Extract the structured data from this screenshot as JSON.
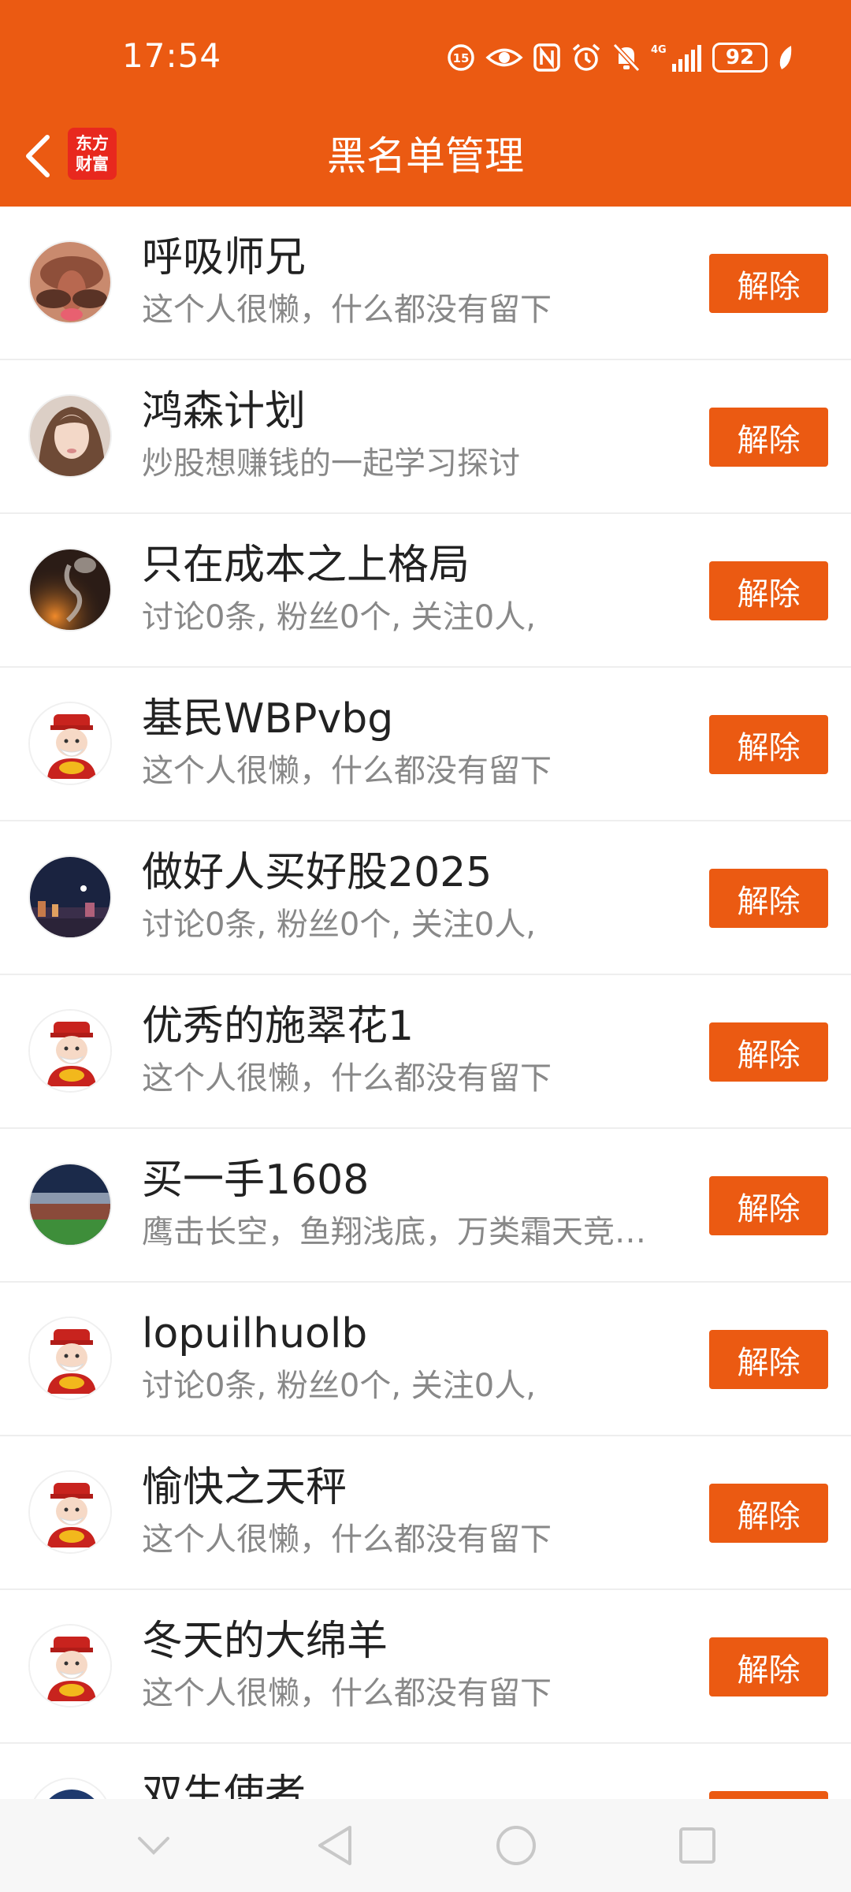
{
  "status_bar": {
    "time": "17:54",
    "battery": "92",
    "network": "4G"
  },
  "nav": {
    "title": "黑名单管理",
    "logo_line1": "东方",
    "logo_line2": "财富"
  },
  "colors": {
    "accent": "#EB5A12",
    "logo_red": "#E8281E",
    "name_text": "#222222",
    "bio_text": "#888888"
  },
  "button_label": "解除",
  "blocked_users": [
    {
      "name": "呼吸师兄",
      "bio": "这个人很懒，什么都没有留下",
      "avatar": "face-closeup-avatar"
    },
    {
      "name": "鸿森计划",
      "bio": "炒股想赚钱的一起学习探讨",
      "avatar": "woman-portrait-avatar"
    },
    {
      "name": "只在成本之上格局",
      "bio": "讨论0条, 粉丝0个, 关注0人,",
      "avatar": "smoke-photo-avatar"
    },
    {
      "name": "基民WBPvbg",
      "bio": "这个人很懒，什么都没有留下",
      "avatar": "fortune-god-avatar"
    },
    {
      "name": "做好人买好股2025",
      "bio": "讨论0条, 粉丝0个, 关注0人,",
      "avatar": "night-city-avatar"
    },
    {
      "name": "优秀的施翠花1",
      "bio": "这个人很懒，什么都没有留下",
      "avatar": "fortune-god-avatar"
    },
    {
      "name": "买一手1608",
      "bio": "鹰击长空，鱼翔浅底，万类霜天竞…",
      "avatar": "stadium-avatar"
    },
    {
      "name": "lopuilhuolb",
      "bio": "讨论0条, 粉丝0个, 关注0人,",
      "avatar": "fortune-god-avatar"
    },
    {
      "name": "愉快之天秤",
      "bio": "这个人很懒，什么都没有留下",
      "avatar": "fortune-god-avatar"
    },
    {
      "name": "冬天的大绵羊",
      "bio": "这个人很懒，什么都没有留下",
      "avatar": "fortune-god-avatar"
    },
    {
      "name": "双生使者",
      "bio": "",
      "avatar": "cartoon-avatar"
    }
  ]
}
